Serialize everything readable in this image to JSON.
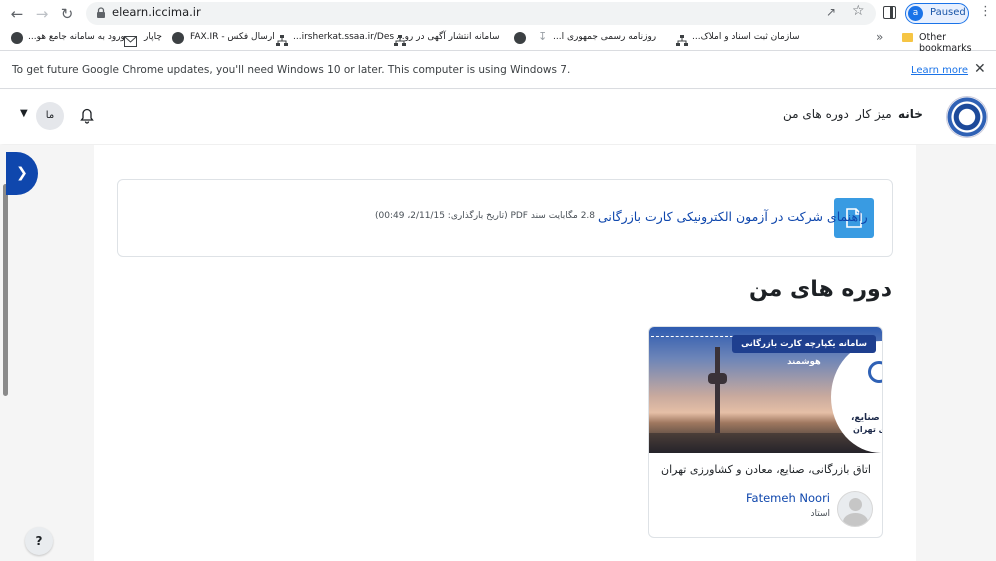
{
  "browser": {
    "url": "elearn.iccima.ir",
    "profile_initial": "a",
    "profile_status": "Paused",
    "bookmarks": [
      {
        "label": "سازمان ثبت اسناد و املاک...",
        "icon": "sitemap-icon"
      },
      {
        "label": "روزنامه رسمی جمهوری ا...",
        "icon": "download-icon"
      },
      {
        "label": "سامانه انتشار آگهی در رو...",
        "icon": "globe-icon"
      },
      {
        "label": "irsherkat.ssaa.ir/Des...",
        "icon": "sitemap-icon"
      },
      {
        "label": "ارسال فکس - FAX.IR",
        "icon": "sitemap-icon"
      },
      {
        "label": "چاپار",
        "icon": "globe-icon"
      },
      {
        "label": "ورود به سامانه جامع هو...",
        "icon": "mail-icon"
      }
    ],
    "other_bookmarks": "Other bookmarks",
    "accent": "#1a73e8"
  },
  "infobar": {
    "message": "To get future Google Chrome updates, you'll need Windows 10 or later. This computer is using Windows 7.",
    "link": "Learn more"
  },
  "navbar": {
    "home": "خانه",
    "dashboard": "میز کار",
    "my_courses": "دوره های من",
    "user_initials": "ما"
  },
  "resource": {
    "title": "راهنمای شرکت در آزمون الکترونیکی کارت بازرگانی",
    "meta": "2.8 مگابایت سند PDF (تاریخ بارگذاری: 2/11/15، 00:49)"
  },
  "courses": {
    "heading": "دوره های من",
    "items": [
      {
        "banner": "سامانه یکپارچه کارت بازرگانی هوشمند",
        "image_text_1": "صنایع،",
        "image_text_2": "زی تهران",
        "title": "اتاق بازرگانی، صنایع، معادن و کشاورزی تهران",
        "teacher": "Fatemeh Noori",
        "role": "استاد"
      }
    ]
  },
  "help_label": "?",
  "brand_color": "#0f47ad"
}
